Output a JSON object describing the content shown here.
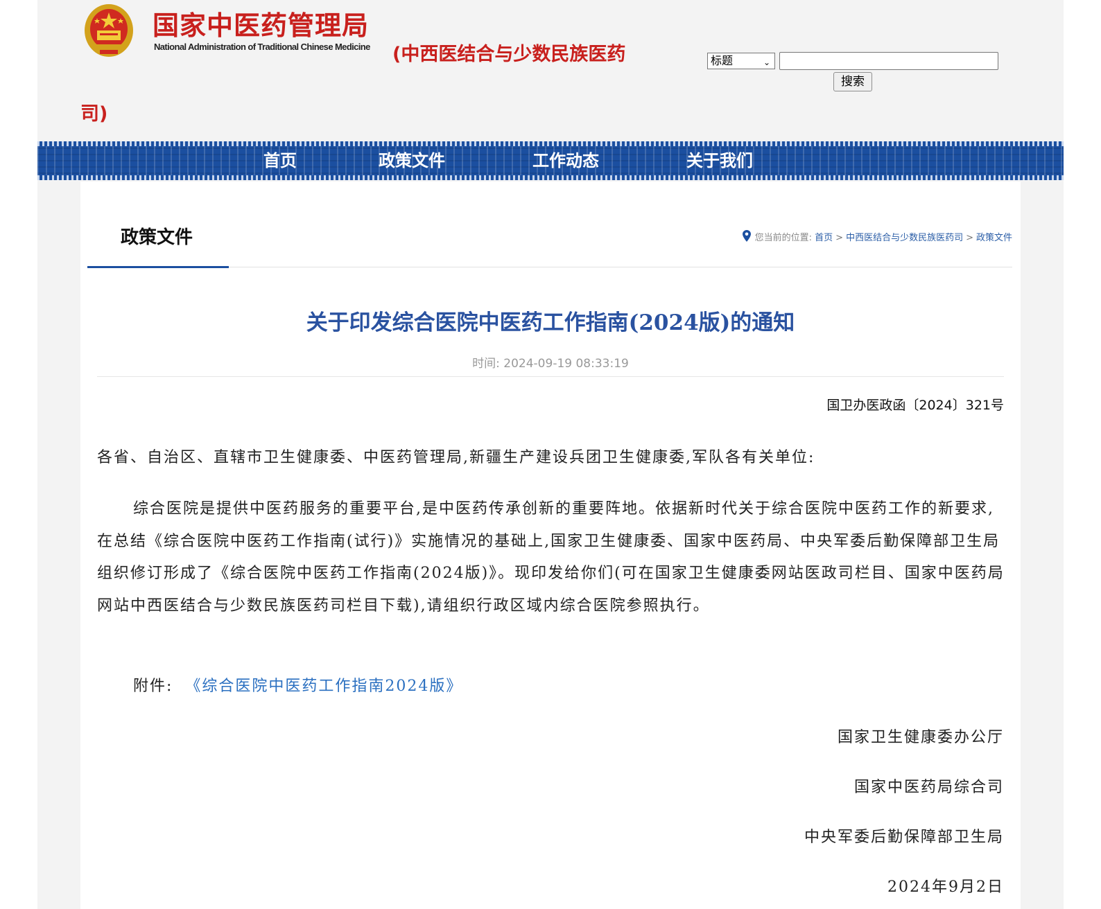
{
  "header": {
    "site_name_cn": "国家中医药管理局",
    "site_name_en": "National Administration of Traditional Chinese Medicine",
    "dept_name_line1": "(中西医结合与少数民族医药",
    "dept_name_line2": "司)",
    "colors": {
      "brand_red": "#c8201d",
      "nav_blue": "#1b4fa0"
    }
  },
  "search": {
    "scope_selected": "标题",
    "input_value": "",
    "button_label": "搜索"
  },
  "nav": {
    "items": [
      "首页",
      "政策文件",
      "工作动态",
      "关于我们"
    ]
  },
  "section": {
    "title": "政策文件"
  },
  "breadcrumb": {
    "label": "您当前的位置:",
    "items": [
      "首页",
      "中西医结合与少数民族医药司",
      "政策文件"
    ],
    "separator": ">"
  },
  "article": {
    "title": "关于印发综合医院中医药工作指南(2024版)的通知",
    "time": "时间: 2024-09-19 08:33:19",
    "doc_number": "国卫办医政函〔2024〕321号",
    "salutation": "各省、自治区、直辖市卫生健康委、中医药管理局,新疆生产建设兵团卫生健康委,军队各有关单位:",
    "paragraph": "综合医院是提供中医药服务的重要平台,是中医药传承创新的重要阵地。依据新时代关于综合医院中医药工作的新要求,在总结《综合医院中医药工作指南(试行)》实施情况的基础上,国家卫生健康委、国家中医药局、中央军委后勤保障部卫生局组织修订形成了《综合医院中医药工作指南(2024版)》。现印发给你们(可在国家卫生健康委网站医政司栏目、国家中医药局网站中西医结合与少数民族医药司栏目下载),请组织行政区域内综合医院参照执行。",
    "attachment_label": "附件:",
    "attachment_link": "《综合医院中医药工作指南2024版》",
    "signatures": [
      "国家卫生健康委办公厅",
      "国家中医药局综合司",
      "中央军委后勤保障部卫生局"
    ],
    "date": "2024年9月2日"
  }
}
